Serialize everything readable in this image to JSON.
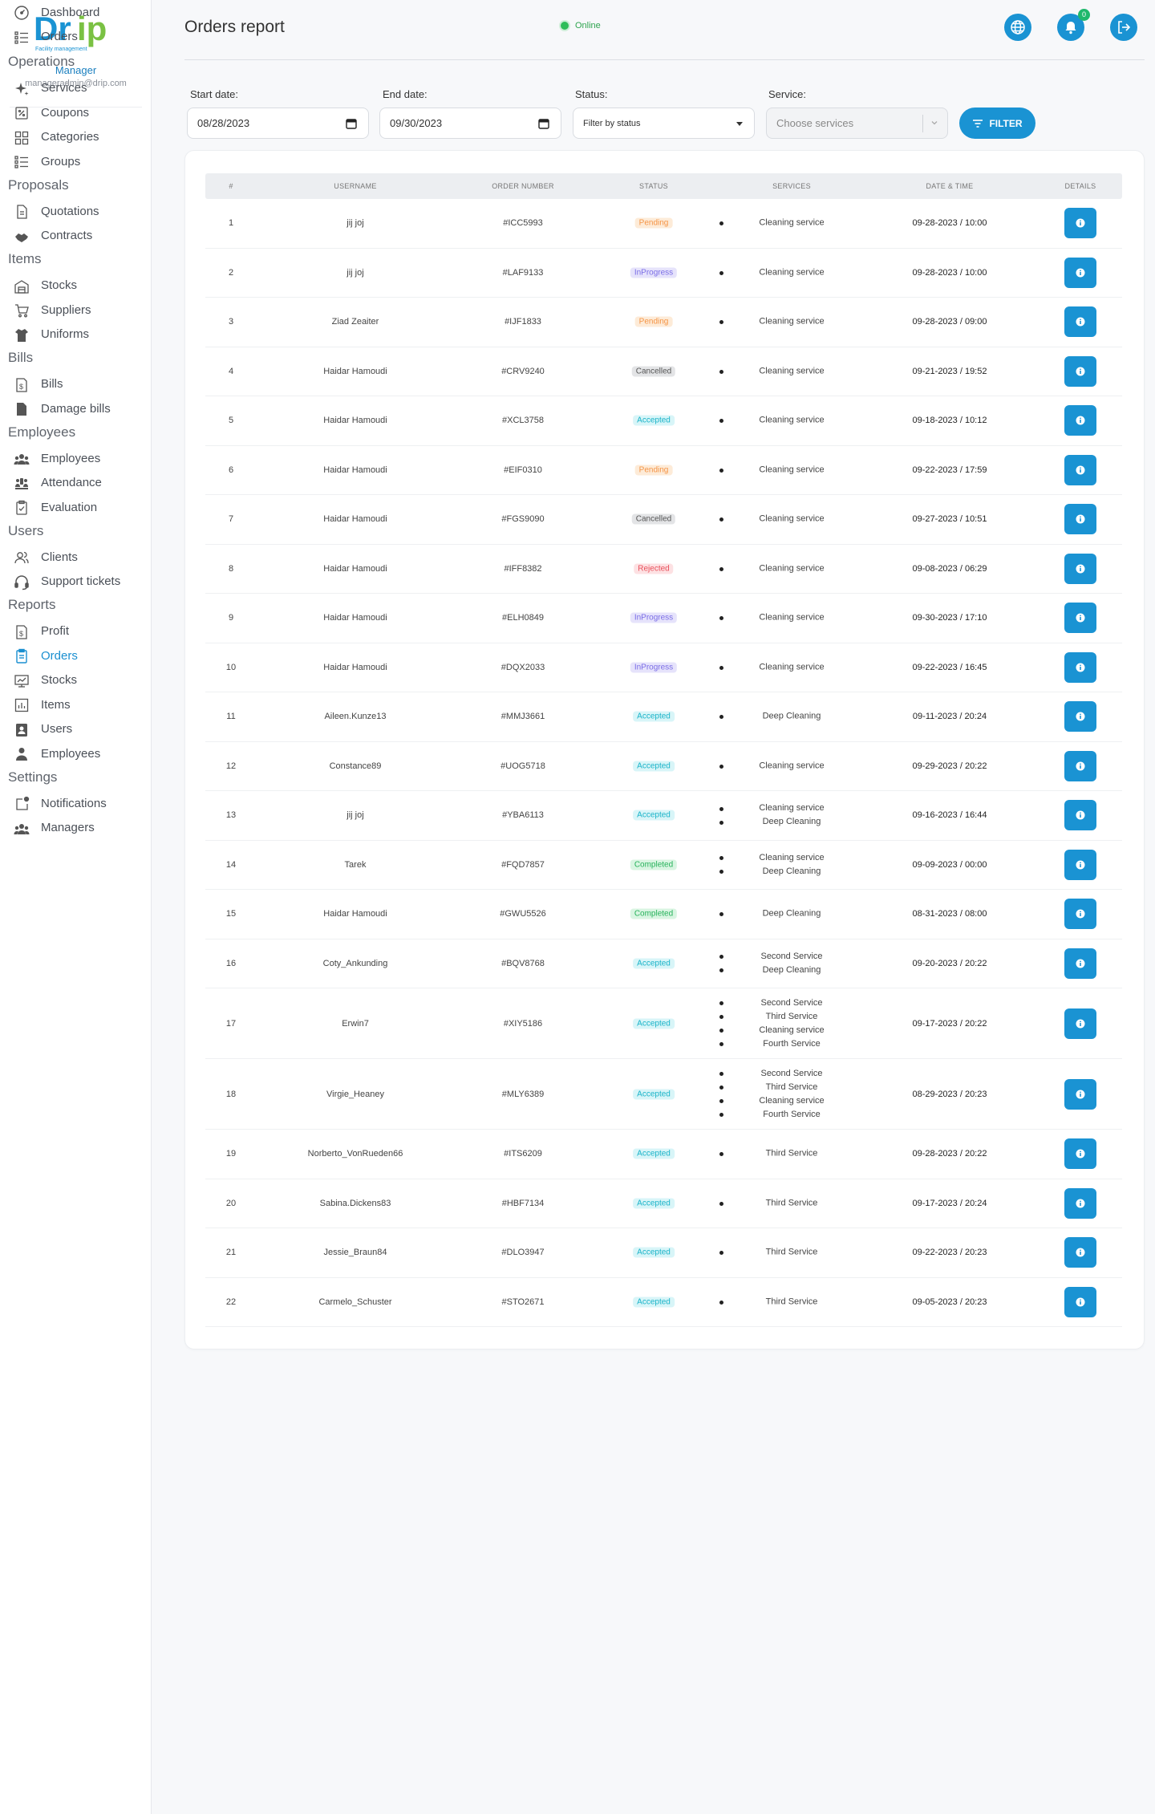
{
  "app": {
    "brand": "Drip",
    "brand_tagline": "Facility management",
    "manager_role": "Manager",
    "manager_email": "manageradmin@drip.com"
  },
  "header": {
    "title": "Orders report",
    "connection_status": "Online",
    "notification_count": "0"
  },
  "sidebar": {
    "top_items": [
      {
        "label": "Dashboard",
        "icon": "gauge-icon"
      },
      {
        "label": "Orders",
        "icon": "list-icon"
      }
    ],
    "sections": [
      {
        "title": "Operations",
        "items": [
          {
            "label": "Services",
            "icon": "sparkle-icon"
          },
          {
            "label": "Coupons",
            "icon": "coupon-icon"
          },
          {
            "label": "Categories",
            "icon": "grid-icon"
          },
          {
            "label": "Groups",
            "icon": "list-icon"
          }
        ]
      },
      {
        "title": "Proposals",
        "items": [
          {
            "label": "Quotations",
            "icon": "document-icon"
          },
          {
            "label": "Contracts",
            "icon": "handshake-icon"
          }
        ]
      },
      {
        "title": "Items",
        "items": [
          {
            "label": "Stocks",
            "icon": "warehouse-icon"
          },
          {
            "label": "Suppliers",
            "icon": "cart-icon"
          },
          {
            "label": "Uniforms",
            "icon": "shirt-icon"
          }
        ]
      },
      {
        "title": "Bills",
        "items": [
          {
            "label": "Bills",
            "icon": "bill-icon"
          },
          {
            "label": "Damage bills",
            "icon": "file-icon"
          }
        ]
      },
      {
        "title": "Employees",
        "items": [
          {
            "label": "Employees",
            "icon": "team-icon"
          },
          {
            "label": "Attendance",
            "icon": "presentation-icon"
          },
          {
            "label": "Evaluation",
            "icon": "clipboard-check-icon"
          }
        ]
      },
      {
        "title": "Users",
        "items": [
          {
            "label": "Clients",
            "icon": "users-icon"
          },
          {
            "label": "Support tickets",
            "icon": "headset-icon"
          }
        ]
      },
      {
        "title": "Reports",
        "items": [
          {
            "label": "Profit",
            "icon": "bill-icon"
          },
          {
            "label": "Orders",
            "icon": "clipboard-icon",
            "active": true
          },
          {
            "label": "Stocks",
            "icon": "monitor-icon"
          },
          {
            "label": "Items",
            "icon": "chart-icon"
          },
          {
            "label": "Users",
            "icon": "user-card-icon"
          },
          {
            "label": "Employees",
            "icon": "employee-icon"
          }
        ]
      },
      {
        "title": "Settings",
        "items": [
          {
            "label": "Notifications",
            "icon": "notification-icon"
          },
          {
            "label": "Managers",
            "icon": "team-icon"
          }
        ]
      }
    ]
  },
  "filters": {
    "start_label": "Start date:",
    "start_value": "08/28/2023",
    "end_label": "End date:",
    "end_value": "09/30/2023",
    "status_label": "Status:",
    "status_value": "Filter by status",
    "service_label": "Service:",
    "service_placeholder": "Choose services",
    "filter_button": "FILTER"
  },
  "table": {
    "columns": [
      "#",
      "USERNAME",
      "ORDER NUMBER",
      "STATUS",
      "SERVICES",
      "DATE & TIME",
      "DETAILS"
    ],
    "rows": [
      {
        "n": "1",
        "user": "jij joj",
        "order": "#ICC5993",
        "status": "Pending",
        "services": [
          "Cleaning service"
        ],
        "dt": "09-28-2023 / 10:00"
      },
      {
        "n": "2",
        "user": "jij joj",
        "order": "#LAF9133",
        "status": "InProgress",
        "services": [
          "Cleaning service"
        ],
        "dt": "09-28-2023 / 10:00"
      },
      {
        "n": "3",
        "user": "Ziad Zeaiter",
        "order": "#IJF1833",
        "status": "Pending",
        "services": [
          "Cleaning service"
        ],
        "dt": "09-28-2023 / 09:00"
      },
      {
        "n": "4",
        "user": "Haidar Hamoudi",
        "order": "#CRV9240",
        "status": "Cancelled",
        "services": [
          "Cleaning service"
        ],
        "dt": "09-21-2023 / 19:52"
      },
      {
        "n": "5",
        "user": "Haidar Hamoudi",
        "order": "#XCL3758",
        "status": "Accepted",
        "services": [
          "Cleaning service"
        ],
        "dt": "09-18-2023 / 10:12"
      },
      {
        "n": "6",
        "user": "Haidar Hamoudi",
        "order": "#EIF0310",
        "status": "Pending",
        "services": [
          "Cleaning service"
        ],
        "dt": "09-22-2023 / 17:59"
      },
      {
        "n": "7",
        "user": "Haidar Hamoudi",
        "order": "#FGS9090",
        "status": "Cancelled",
        "services": [
          "Cleaning service"
        ],
        "dt": "09-27-2023 / 10:51"
      },
      {
        "n": "8",
        "user": "Haidar Hamoudi",
        "order": "#IFF8382",
        "status": "Rejected",
        "services": [
          "Cleaning service"
        ],
        "dt": "09-08-2023 / 06:29"
      },
      {
        "n": "9",
        "user": "Haidar Hamoudi",
        "order": "#ELH0849",
        "status": "InProgress",
        "services": [
          "Cleaning service"
        ],
        "dt": "09-30-2023 / 17:10"
      },
      {
        "n": "10",
        "user": "Haidar Hamoudi",
        "order": "#DQX2033",
        "status": "InProgress",
        "services": [
          "Cleaning service"
        ],
        "dt": "09-22-2023 / 16:45"
      },
      {
        "n": "11",
        "user": "Aileen.Kunze13",
        "order": "#MMJ3661",
        "status": "Accepted",
        "services": [
          "Deep Cleaning"
        ],
        "dt": "09-11-2023 / 20:24"
      },
      {
        "n": "12",
        "user": "Constance89",
        "order": "#UOG5718",
        "status": "Accepted",
        "services": [
          "Cleaning service"
        ],
        "dt": "09-29-2023 / 20:22"
      },
      {
        "n": "13",
        "user": "jij joj",
        "order": "#YBA6113",
        "status": "Accepted",
        "services": [
          "Cleaning service",
          "Deep Cleaning"
        ],
        "dt": "09-16-2023 / 16:44"
      },
      {
        "n": "14",
        "user": "Tarek",
        "order": "#FQD7857",
        "status": "Completed",
        "services": [
          "Cleaning service",
          "Deep Cleaning"
        ],
        "dt": "09-09-2023 / 00:00"
      },
      {
        "n": "15",
        "user": "Haidar Hamoudi",
        "order": "#GWU5526",
        "status": "Completed",
        "services": [
          "Deep Cleaning"
        ],
        "dt": "08-31-2023 / 08:00"
      },
      {
        "n": "16",
        "user": "Coty_Ankunding",
        "order": "#BQV8768",
        "status": "Accepted",
        "services": [
          "Second Service",
          "Deep Cleaning"
        ],
        "dt": "09-20-2023 / 20:22"
      },
      {
        "n": "17",
        "user": "Erwin7",
        "order": "#XIY5186",
        "status": "Accepted",
        "services": [
          "Second Service",
          "Third Service",
          "Cleaning service",
          "Fourth Service"
        ],
        "dt": "09-17-2023 / 20:22"
      },
      {
        "n": "18",
        "user": "Virgie_Heaney",
        "order": "#MLY6389",
        "status": "Accepted",
        "services": [
          "Second Service",
          "Third Service",
          "Cleaning service",
          "Fourth Service"
        ],
        "dt": "08-29-2023 / 20:23"
      },
      {
        "n": "19",
        "user": "Norberto_VonRueden66",
        "order": "#ITS6209",
        "status": "Accepted",
        "services": [
          "Third Service"
        ],
        "dt": "09-28-2023 / 20:22"
      },
      {
        "n": "20",
        "user": "Sabina.Dickens83",
        "order": "#HBF7134",
        "status": "Accepted",
        "services": [
          "Third Service"
        ],
        "dt": "09-17-2023 / 20:24"
      },
      {
        "n": "21",
        "user": "Jessie_Braun84",
        "order": "#DLO3947",
        "status": "Accepted",
        "services": [
          "Third Service"
        ],
        "dt": "09-22-2023 / 20:23"
      },
      {
        "n": "22",
        "user": "Carmelo_Schuster",
        "order": "#STO2671",
        "status": "Accepted",
        "services": [
          "Third Service"
        ],
        "dt": "09-05-2023 / 20:23"
      }
    ]
  },
  "colors": {
    "accent": "#1a93d3",
    "brand_blue": "#1a8fd0",
    "brand_green": "#7ac143",
    "online": "#2ebd59"
  }
}
